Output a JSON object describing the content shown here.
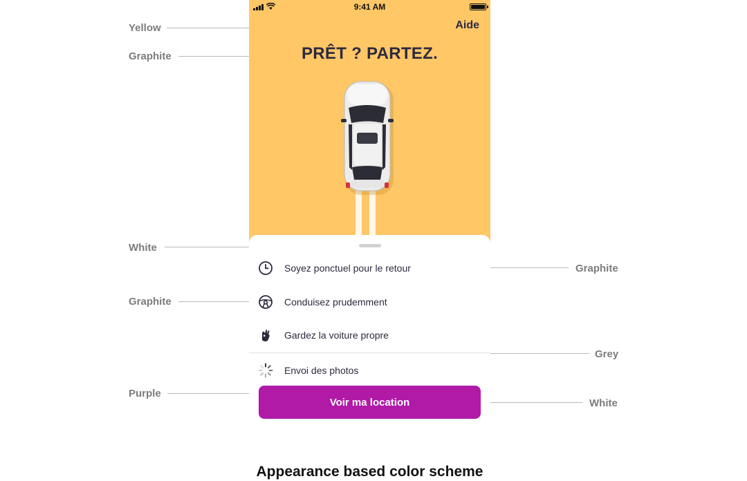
{
  "colors": {
    "yellow": "#ffc766",
    "graphite": "#2d2a3f",
    "white": "#ffffff",
    "grey": "#e3e3e3",
    "purple": "#b01aa7",
    "annotation": "#7c7c7c"
  },
  "annotations": [
    {
      "label": "Yellow"
    },
    {
      "label": "Graphite"
    },
    {
      "label": "White"
    },
    {
      "label": "Graphite"
    },
    {
      "label": "Purple"
    },
    {
      "label": "Graphite"
    },
    {
      "label": "Grey"
    },
    {
      "label": "White"
    }
  ],
  "status_bar": {
    "time": "9:41 AM",
    "battery_percent": 100
  },
  "header": {
    "help_label": "Aide",
    "title": "PRÊT ? PARTEZ."
  },
  "car_illustration": {
    "icon": "car-top-view-illustration"
  },
  "sheet": {
    "items": [
      {
        "label": "Soyez ponctuel pour le retour",
        "icon": "clock-icon"
      },
      {
        "label": "Conduisez prudemment",
        "icon": "steering-wheel-icon"
      },
      {
        "label": "Gardez la voiture propre",
        "icon": "ok-hand-icon"
      },
      {
        "label": "Envoi des photos",
        "icon": "loading-spinner-icon"
      }
    ],
    "cta_label": "Voir ma location"
  },
  "caption": "Appearance based color scheme"
}
